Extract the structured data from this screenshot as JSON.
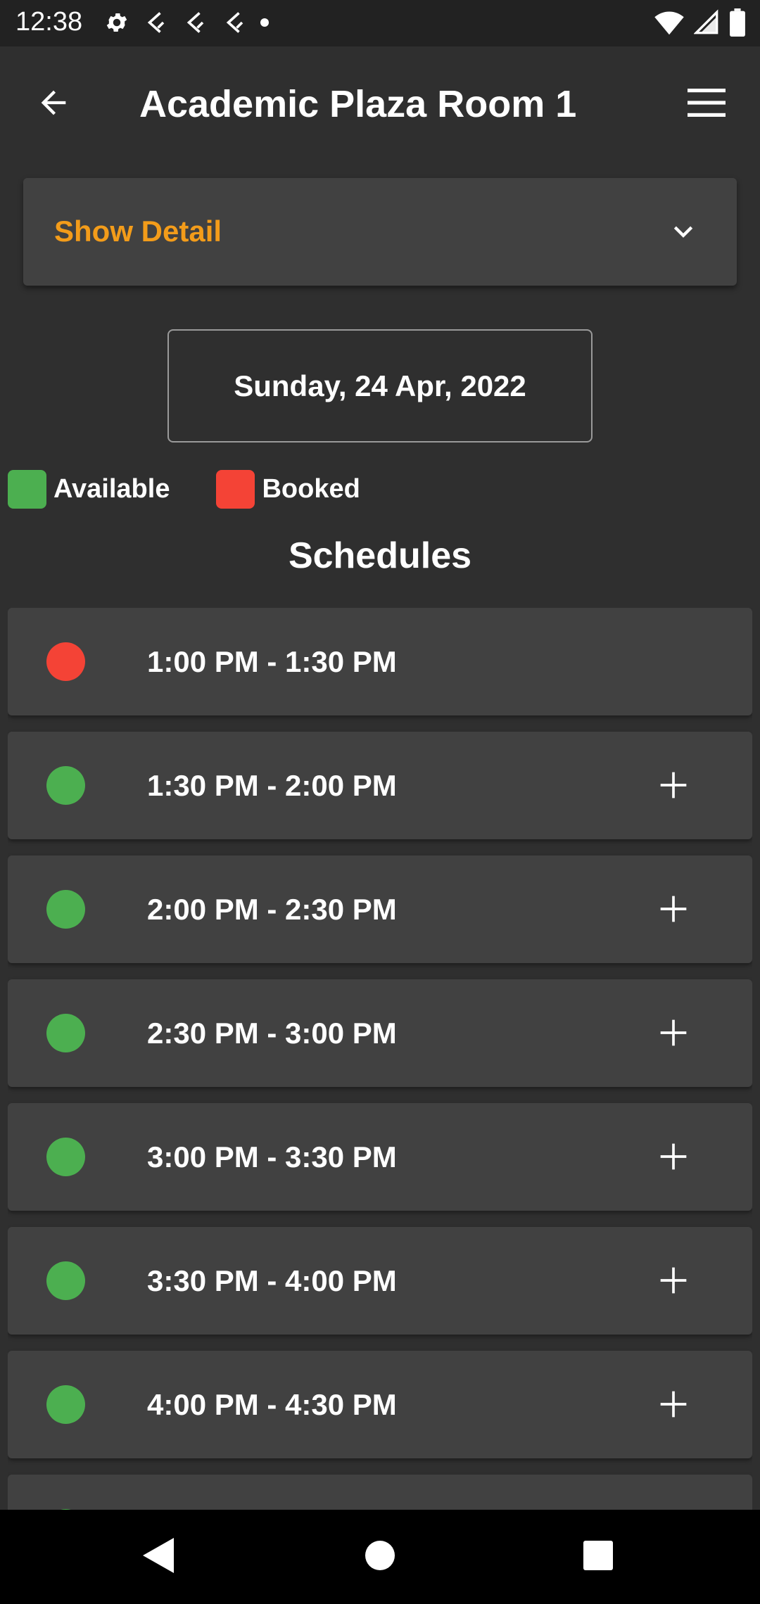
{
  "status_bar": {
    "time": "12:38",
    "left_icons": [
      "settings-icon",
      "flutter-icon",
      "flutter-icon",
      "flutter-icon",
      "dot-icon"
    ],
    "right_icons": [
      "wifi-icon",
      "signal-icon",
      "battery-icon"
    ]
  },
  "app_bar": {
    "title": "Academic Plaza Room 1",
    "back_icon": "arrow-back-icon",
    "menu_icon": "menu-icon"
  },
  "detail_panel": {
    "label": "Show Detail",
    "label_color": "#f39c1a",
    "chevron_icon": "chevron-down-icon"
  },
  "date": {
    "text": "Sunday, 24 Apr, 2022"
  },
  "legend": {
    "available": {
      "label": "Available",
      "color": "#4caf50"
    },
    "booked": {
      "label": "Booked",
      "color": "#f44336"
    }
  },
  "schedules": {
    "title": "Schedules",
    "slots": [
      {
        "time": "1:00 PM - 1:30 PM",
        "status": "booked"
      },
      {
        "time": "1:30 PM - 2:00 PM",
        "status": "available"
      },
      {
        "time": "2:00 PM - 2:30 PM",
        "status": "available"
      },
      {
        "time": "2:30 PM - 3:00 PM",
        "status": "available"
      },
      {
        "time": "3:00 PM - 3:30 PM",
        "status": "available"
      },
      {
        "time": "3:30 PM - 4:00 PM",
        "status": "available"
      },
      {
        "time": "4:00 PM - 4:30 PM",
        "status": "available"
      },
      {
        "time": "",
        "status": "available"
      }
    ]
  },
  "nav_bar": {
    "icons": [
      "nav-back-icon",
      "nav-home-icon",
      "nav-recents-icon"
    ]
  }
}
